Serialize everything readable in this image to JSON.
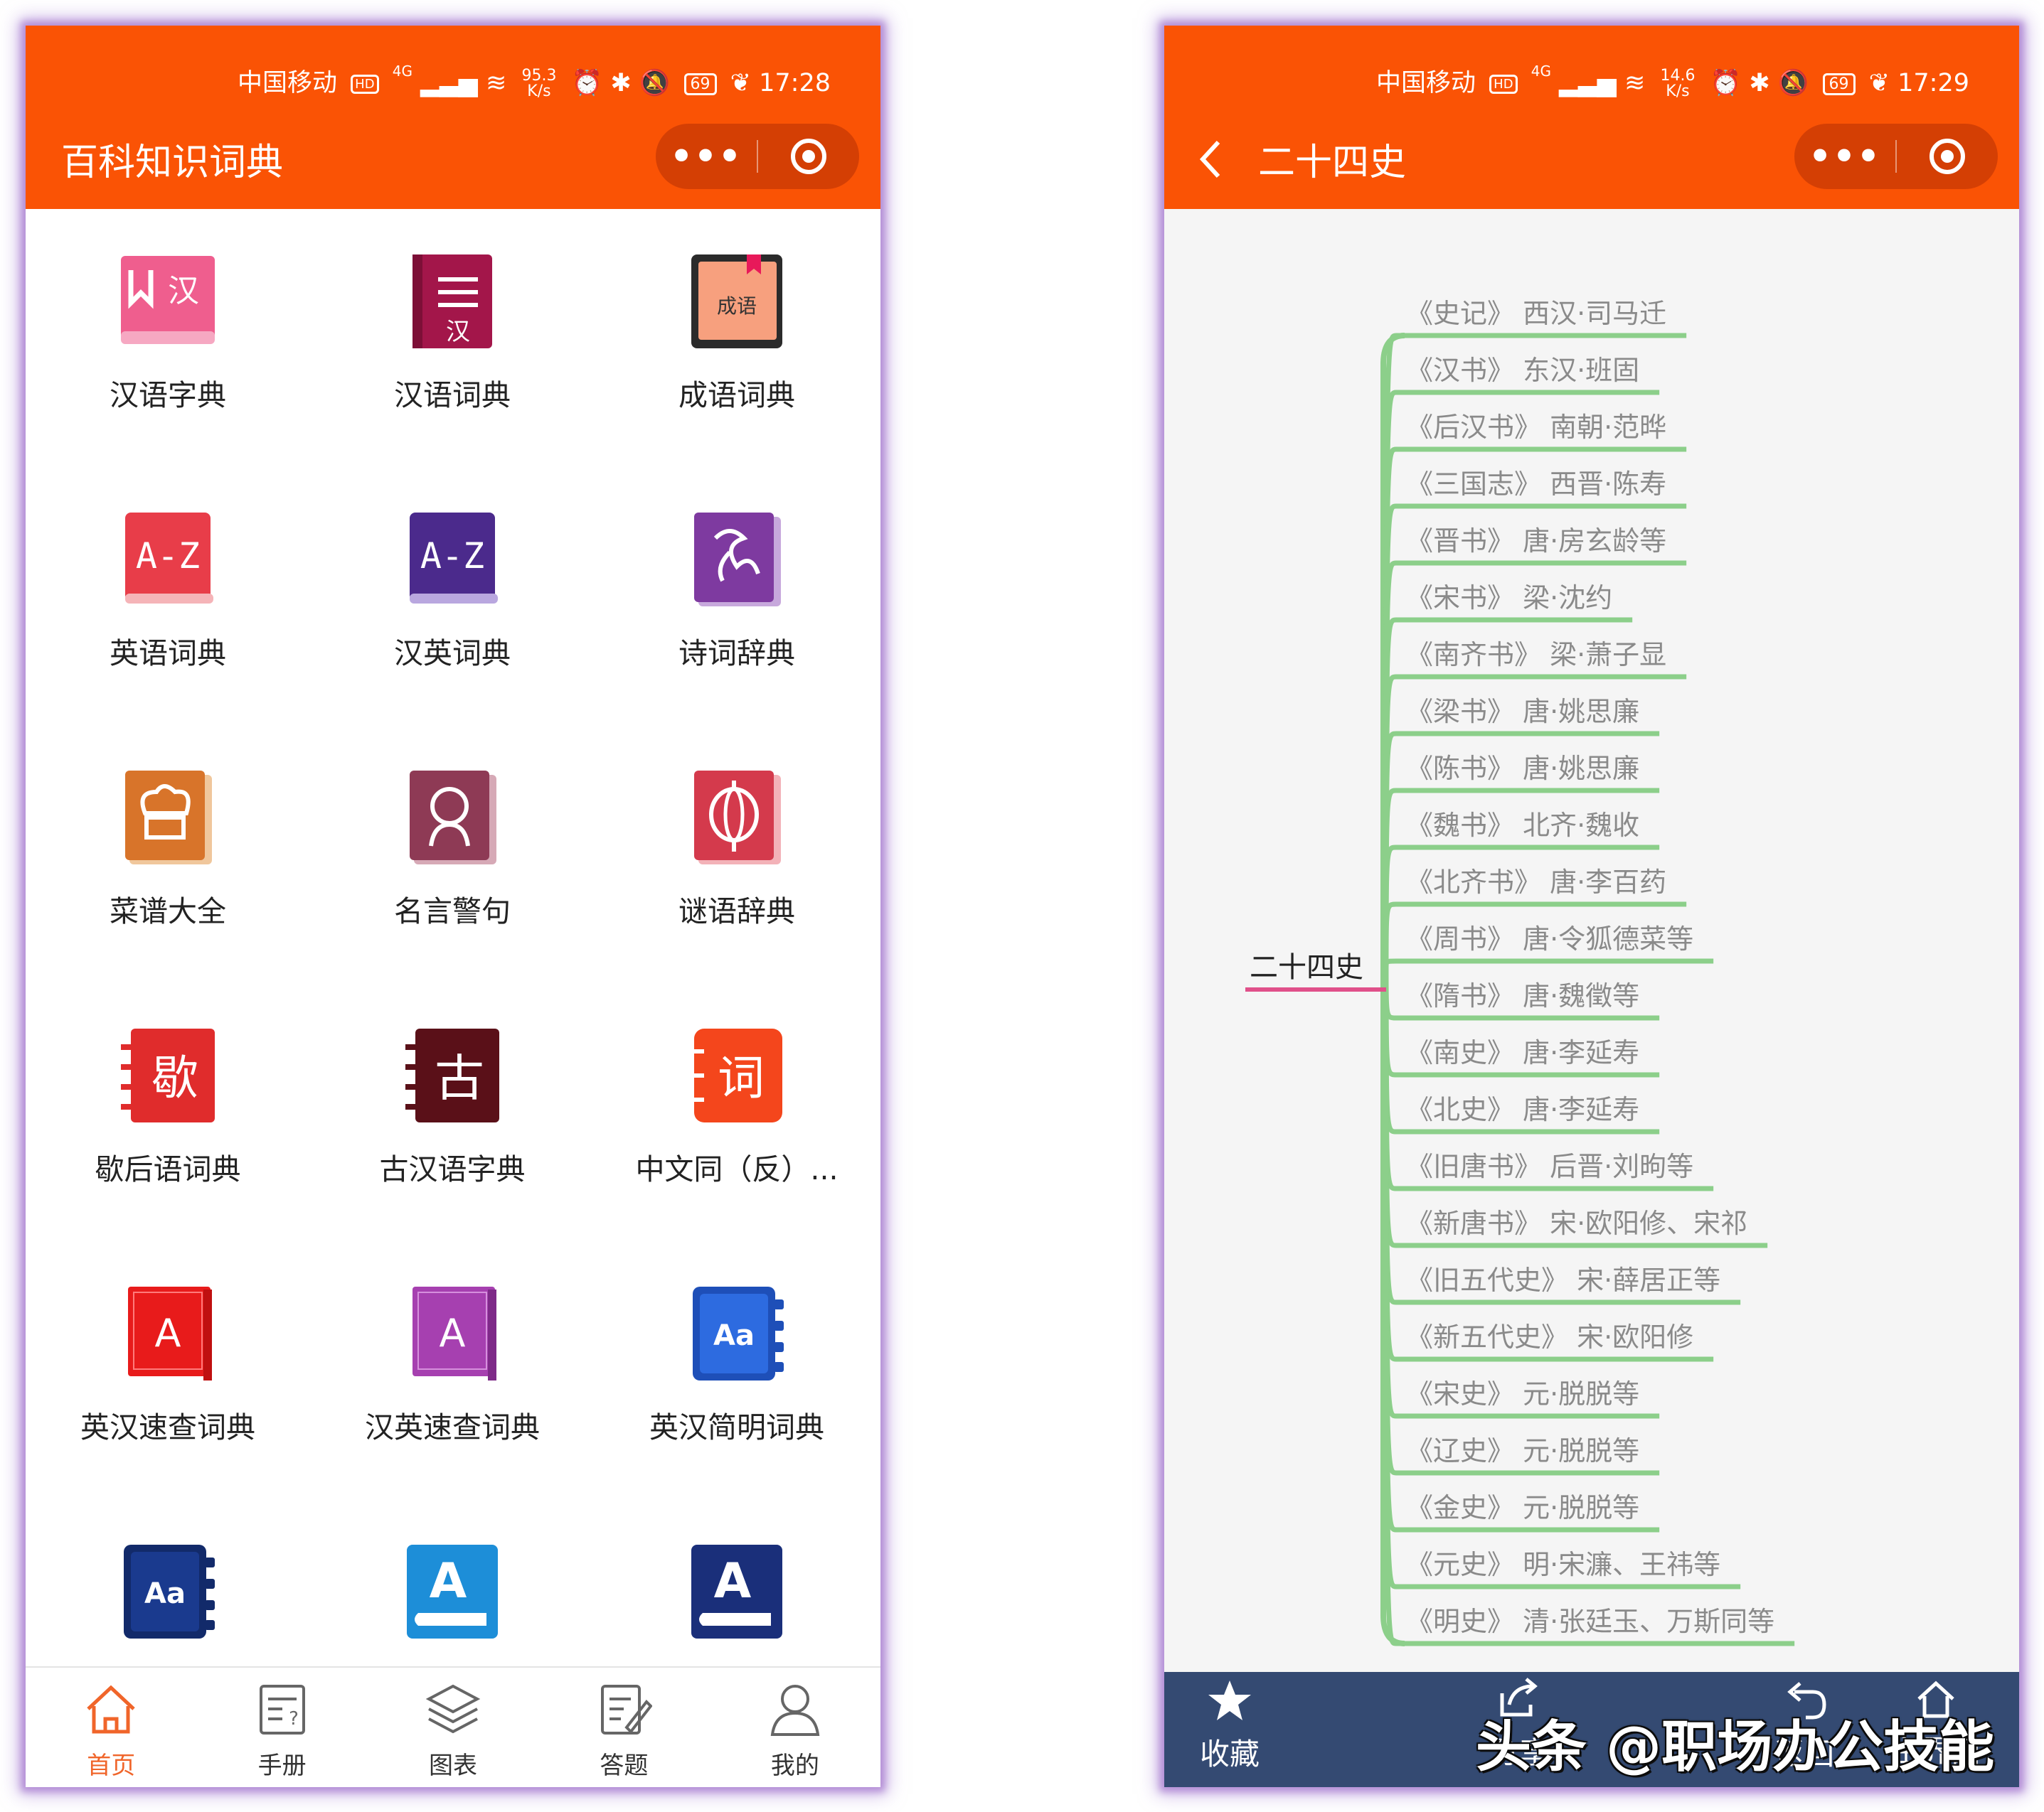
{
  "left": {
    "status": {
      "carrier": "中国移动",
      "hd": "HD",
      "signal": "4G",
      "speed_value": "95.3",
      "speed_unit": "K/s",
      "battery": "69",
      "time": "17:28"
    },
    "title": "百科知识词典",
    "menu_dots": "•••",
    "tiles": [
      {
        "label": "汉语字典",
        "icon": "hanzi-dictionary-icon"
      },
      {
        "label": "汉语词典",
        "icon": "chinese-words-dictionary-icon"
      },
      {
        "label": "成语词典",
        "icon": "idiom-book-icon",
        "icon_text": "成语"
      },
      {
        "label": "英语词典",
        "icon": "az-red-book-icon",
        "icon_text": "A-Z"
      },
      {
        "label": "汉英词典",
        "icon": "az-purple-book-icon",
        "icon_text": "A-Z"
      },
      {
        "label": "诗词辞典",
        "icon": "poetry-book-icon"
      },
      {
        "label": "菜谱大全",
        "icon": "chef-hat-icon"
      },
      {
        "label": "名言警句",
        "icon": "thinker-icon"
      },
      {
        "label": "谜语辞典",
        "icon": "lantern-icon"
      },
      {
        "label": "歇后语词典",
        "icon": "xie-notebook-icon",
        "icon_text": "歇"
      },
      {
        "label": "古汉语字典",
        "icon": "gu-notebook-icon",
        "icon_text": "古"
      },
      {
        "label": "中文同（反）...",
        "icon": "ci-notebook-icon",
        "icon_text": "词"
      },
      {
        "label": "英汉速查词典",
        "icon": "a-red-book-icon",
        "icon_text": "A"
      },
      {
        "label": "汉英速查词典",
        "icon": "a-purple-book-icon",
        "icon_text": "A"
      },
      {
        "label": "英汉简明词典",
        "icon": "aa-blue-notebook-icon",
        "icon_text": "Aa"
      },
      {
        "label": "",
        "icon": "aa-navy-notebook-icon",
        "icon_text": "Aa"
      },
      {
        "label": "",
        "icon": "a-lightblue-book-icon",
        "icon_text": "A"
      },
      {
        "label": "",
        "icon": "a-navy-book-icon",
        "icon_text": "A"
      }
    ],
    "tabs": [
      {
        "label": "首页",
        "icon": "home-icon",
        "active": true
      },
      {
        "label": "手册",
        "icon": "manual-icon",
        "active": false
      },
      {
        "label": "图表",
        "icon": "layers-icon",
        "active": false
      },
      {
        "label": "答题",
        "icon": "quiz-edit-icon",
        "active": false
      },
      {
        "label": "我的",
        "icon": "user-icon",
        "active": false
      }
    ]
  },
  "right": {
    "status": {
      "carrier": "中国移动",
      "hd": "HD",
      "signal": "4G",
      "speed_value": "14.6",
      "speed_unit": "K/s",
      "battery": "69",
      "time": "17:29"
    },
    "title": "二十四史",
    "menu_dots": "•••",
    "mindmap": {
      "root": "二十四史",
      "branches": [
        {
          "book": "《史记》",
          "author": "西汉·司马迁"
        },
        {
          "book": "《汉书》",
          "author": "东汉·班固"
        },
        {
          "book": "《后汉书》",
          "author": "南朝·范晔"
        },
        {
          "book": "《三国志》",
          "author": "西晋·陈寿"
        },
        {
          "book": "《晋书》",
          "author": "唐·房玄龄等"
        },
        {
          "book": "《宋书》",
          "author": "梁·沈约"
        },
        {
          "book": "《南齐书》",
          "author": "梁·萧子显"
        },
        {
          "book": "《梁书》",
          "author": "唐·姚思廉"
        },
        {
          "book": "《陈书》",
          "author": "唐·姚思廉"
        },
        {
          "book": "《魏书》",
          "author": "北齐·魏收"
        },
        {
          "book": "《北齐书》",
          "author": "唐·李百药"
        },
        {
          "book": "《周书》",
          "author": "唐·令狐德菜等"
        },
        {
          "book": "《隋书》",
          "author": "唐·魏徵等"
        },
        {
          "book": "《南史》",
          "author": "唐·李延寿"
        },
        {
          "book": "《北史》",
          "author": "唐·李延寿"
        },
        {
          "book": "《旧唐书》",
          "author": "后晋·刘昫等"
        },
        {
          "book": "《新唐书》",
          "author": "宋·欧阳修、宋祁"
        },
        {
          "book": "《旧五代史》",
          "author": "宋·薛居正等"
        },
        {
          "book": "《新五代史》",
          "author": "宋·欧阳修"
        },
        {
          "book": "《宋史》",
          "author": "元·脱脱等"
        },
        {
          "book": "《辽史》",
          "author": "元·脱脱等"
        },
        {
          "book": "《金史》",
          "author": "元·脱脱等"
        },
        {
          "book": "《元史》",
          "author": "明·宋濂、王祎等"
        },
        {
          "book": "《明史》",
          "author": "清·张廷玉、万斯同等"
        }
      ]
    },
    "bottom": {
      "collect": "收藏",
      "share": "分享",
      "back": "返回",
      "main": "主界面"
    }
  },
  "watermark": "头条 @职场办公技能",
  "colors": {
    "brand_orange": "#fa5305",
    "branch_green": "#8ccf8a",
    "root_underline": "#e0508a",
    "bottom_navy": "#344a72",
    "active_tab": "#f0652a"
  }
}
